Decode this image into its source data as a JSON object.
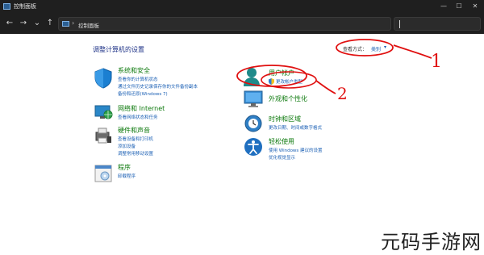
{
  "window": {
    "title": "控制面板",
    "controls": [
      "—",
      "☐",
      "✕"
    ]
  },
  "addressbar": {
    "nav": [
      "←",
      "→",
      "⌄",
      "↑"
    ],
    "separator": "›",
    "breadcrumb": "控制面板",
    "search_placeholder": ""
  },
  "main": {
    "heading": "调整计算机的设置",
    "view_by_label": "查看方式：",
    "view_by_value": "类别",
    "view_by_chevron": "▾"
  },
  "left_categories": [
    {
      "title": "系统和安全",
      "links": [
        "查看你的计算机状态",
        "通过文件历史记录保存你的文件备份副本",
        "备份和还原(Windows 7)"
      ]
    },
    {
      "title": "网络和 Internet",
      "links": [
        "查看网络状态和任务"
      ]
    },
    {
      "title": "硬件和声音",
      "links": [
        "查看设备和打印机",
        "添加设备",
        "调整常用移动设置"
      ]
    },
    {
      "title": "程序",
      "links": [
        "卸载程序"
      ]
    }
  ],
  "right_categories": [
    {
      "title": "用户帐户",
      "links": [
        "更改帐户类型"
      ]
    },
    {
      "title": "外观和个性化",
      "links": []
    },
    {
      "title": "时钟和区域",
      "links": [
        "更改日期、时间或数字格式"
      ]
    },
    {
      "title": "轻松使用",
      "links": [
        "使用 Windows 建议的设置",
        "优化视觉显示"
      ]
    }
  ],
  "annotations": [
    "1",
    "2"
  ],
  "brand": "元码手游网",
  "colors": {
    "chrome": "#1f1f1f",
    "heading": "#1e3287",
    "category_title": "#0e7a0e",
    "link": "#1a5fb4",
    "annotation": "#e01010"
  }
}
